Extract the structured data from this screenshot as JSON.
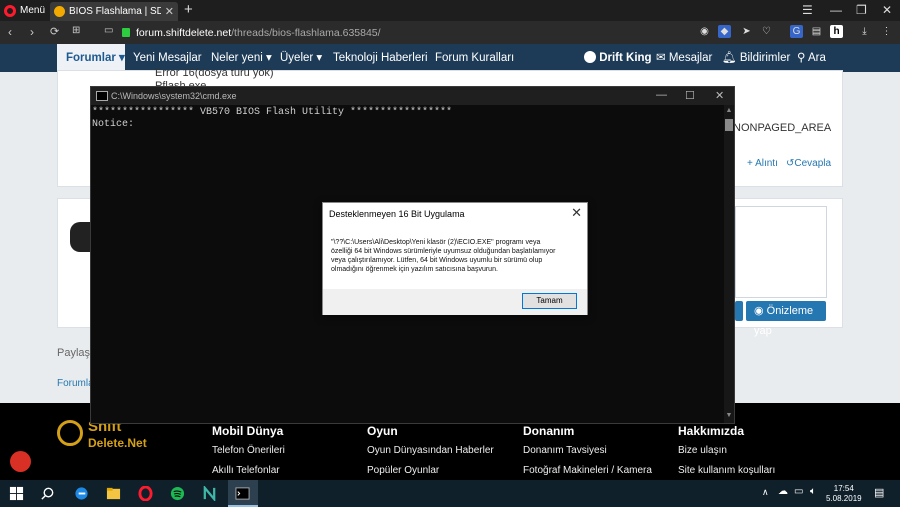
{
  "browser": {
    "menu_label": "Menü",
    "tab_title": "BIOS Flashlama | SDN Foru",
    "tab_close": "✕",
    "new_tab": "+",
    "url_host": "forum.shiftdelete.net",
    "url_path": "/threads/bios-flashlama.635845/"
  },
  "forum_nav": {
    "items": [
      "Forumlar",
      "Yeni Mesajlar",
      "Neler yeni",
      "Üyeler",
      "Teknoloji Haberleri",
      "Forum Kuralları"
    ],
    "user": "Drift King",
    "messages": "Mesajlar",
    "alerts": "Bildirimler",
    "search": "Ara"
  },
  "page": {
    "line1": "Error 16(dosya türü yok)",
    "line2": "Pflash.exe",
    "nonpaged": "NONPAGED_AREA",
    "quote": "+ Alıntı",
    "reply": "Cevapla",
    "preview": "Önizleme yap",
    "share": "Paylaş:",
    "breadcrumb": "Forumlar"
  },
  "cmd": {
    "title": "C:\\Windows\\system32\\cmd.exe",
    "line1": "***************** VB570 BIOS Flash Utility *****************",
    "line2": "Notice:"
  },
  "dialog": {
    "title": "Desteklenmeyen 16 Bit Uygulama",
    "message": "\"\\??\\C:\\Users\\Ali\\Desktop\\Yeni klasör (2)\\ECIO.EXE\" programı veya özelliği 64 bit Windows sürümleriyle uyumsuz olduğundan başlatılamıyor veya çalıştırılamıyor. Lütfen, 64 bit Windows uyumlu bir sürümü olup olmadığını öğrenmek için yazılım satıcısına başvurun.",
    "ok": "Tamam"
  },
  "footer": {
    "logo_top": "Shift",
    "logo_bottom": "Delete.Net",
    "columns": [
      {
        "title": "Mobil Dünya",
        "links": [
          "Telefon Önerileri",
          "Akıllı Telefonlar"
        ]
      },
      {
        "title": "Oyun",
        "links": [
          "Oyun Dünyasından Haberler",
          "Popüler Oyunlar"
        ]
      },
      {
        "title": "Donanım",
        "links": [
          "Donanım Tavsiyesi",
          "Fotoğraf Makineleri / Kamera"
        ]
      },
      {
        "title": "Hakkımızda",
        "links": [
          "Bize ulaşın",
          "Site kullanım koşulları"
        ]
      }
    ]
  },
  "taskbar": {
    "time": "17:54",
    "date": "5.08.2019"
  },
  "colors": {
    "forum_nav": "#1d3b57",
    "accent_blue": "#2577b1",
    "opera_red": "#ff1b2d",
    "footer_gold": "#d4a017"
  }
}
